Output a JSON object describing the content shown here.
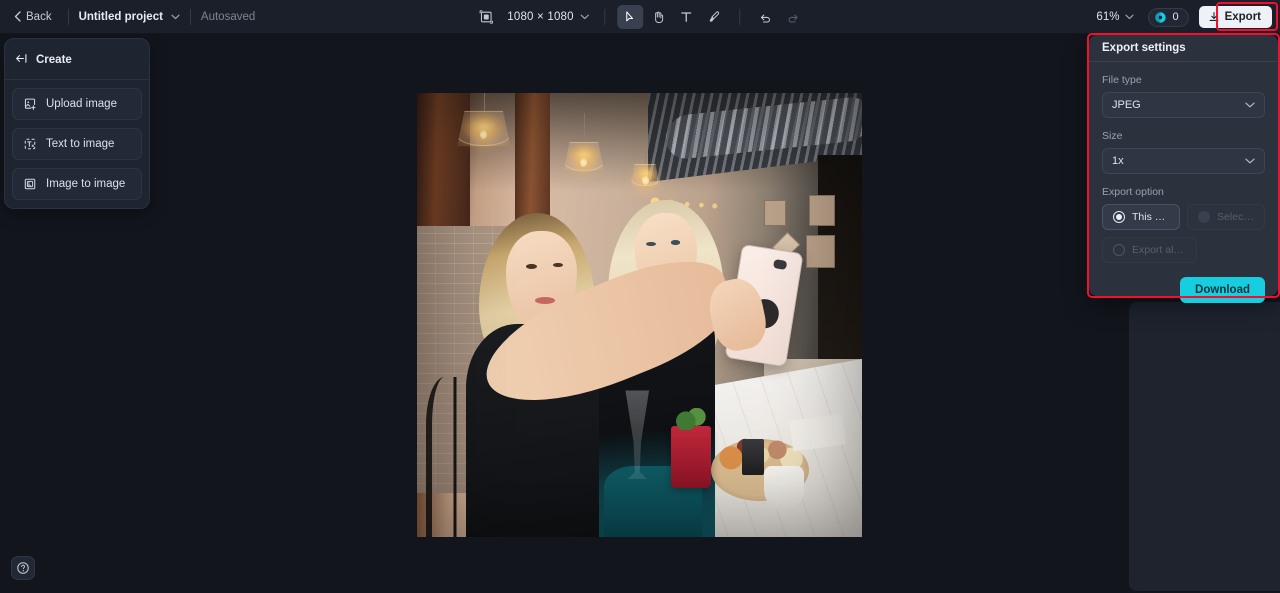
{
  "topbar": {
    "back_label": "Back",
    "project_name": "Untitled project",
    "autosave_status": "Autosaved",
    "canvas_size": "1080 × 1080",
    "zoom_level": "61%",
    "credits_count": "0",
    "export_label": "Export",
    "tools": [
      {
        "name": "select-tool",
        "title": "Select",
        "active": true
      },
      {
        "name": "hand-tool",
        "title": "Hand",
        "active": false
      },
      {
        "name": "text-tool",
        "title": "Text",
        "active": false
      },
      {
        "name": "brush-tool",
        "title": "Brush",
        "active": false
      },
      {
        "name": "undo-tool",
        "title": "Undo",
        "active": false
      },
      {
        "name": "redo-tool",
        "title": "Redo",
        "active": false
      }
    ]
  },
  "create_panel": {
    "title": "Create",
    "items": [
      {
        "label": "Upload image",
        "icon": "upload-image-icon"
      },
      {
        "label": "Text to image",
        "icon": "text-to-image-icon"
      },
      {
        "label": "Image to image",
        "icon": "image-to-image-icon"
      }
    ]
  },
  "export_panel": {
    "title": "Export settings",
    "file_type_label": "File type",
    "file_type_value": "JPEG",
    "size_label": "Size",
    "size_value": "1x",
    "export_option_label": "Export option",
    "options": [
      {
        "label": "This canvas",
        "selected": true,
        "disabled": false
      },
      {
        "label": "Selected l...",
        "selected": false,
        "disabled": true
      },
      {
        "label": "Export all ...",
        "selected": false,
        "disabled": true
      }
    ],
    "download_label": "Download"
  },
  "help": {
    "label": "?"
  },
  "colors": {
    "accent_cyan": "#17cde0",
    "highlight_red": "#f50f2d",
    "panel_bg": "#2b313d",
    "topbar_bg": "#1b1f29",
    "canvas_bg": "#12151c"
  }
}
